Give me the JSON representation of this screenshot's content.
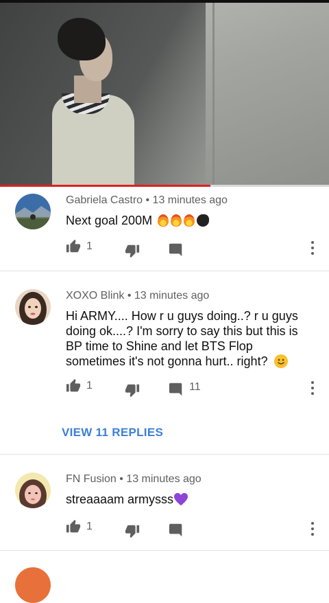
{
  "video": {
    "progress_fraction": 0.64
  },
  "comments": [
    {
      "author": "Gabriela Castro",
      "time": "13 minutes ago",
      "text": "Next goal 200M",
      "likes": "1",
      "replies_count": ""
    },
    {
      "author": "XOXO Blink",
      "time": "13 minutes ago",
      "text": "Hi ARMY.... How r u guys doing..? r u guys doing ok....? I'm sorry to say this but this is BP time to Shine and let BTS Flop sometimes it's not gonna hurt.. right?",
      "likes": "1",
      "replies_count": "11",
      "view_replies_label": "VIEW 11 REPLIES"
    },
    {
      "author": "FN Fusion",
      "time": "13 minutes ago",
      "text": "streaaaam armysss",
      "likes": "1",
      "replies_count": ""
    }
  ],
  "colors": {
    "accent_red": "#e02020",
    "link_blue": "#3d7fd6",
    "meta_gray": "#606060"
  },
  "icons": [
    "thumbs-up-icon",
    "thumbs-down-icon",
    "reply-icon",
    "more-vert-icon",
    "fire-emoji",
    "speaking-head-emoji",
    "smile-emoji",
    "purple-heart-emoji"
  ]
}
